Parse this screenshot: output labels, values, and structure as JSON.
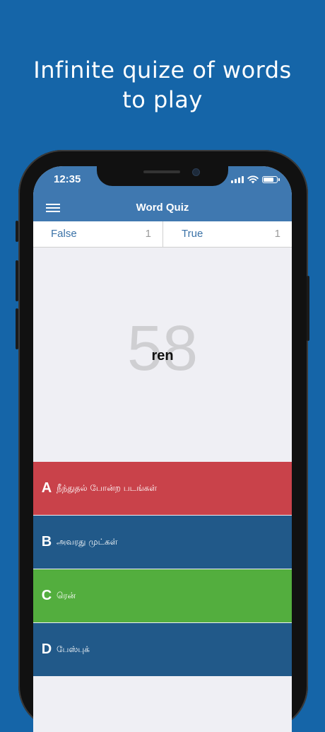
{
  "promo": {
    "headline_line1": "Infinite quize of words",
    "headline_line2": "to play"
  },
  "status_bar": {
    "time": "12:35",
    "battery_level": 0.85
  },
  "app": {
    "title": "Word Quiz"
  },
  "score": {
    "false_label": "False",
    "false_count": "1",
    "true_label": "True",
    "true_count": "1"
  },
  "question": {
    "timer": "58",
    "word": "ren"
  },
  "answers": [
    {
      "letter": "A",
      "text": "நீந்துதல் போன்ற படங்கள்",
      "color": "#c9424a"
    },
    {
      "letter": "B",
      "text": "அவரது முட்கள்",
      "color": "#215989"
    },
    {
      "letter": "C",
      "text": "ரென்",
      "color": "#53ae3e"
    },
    {
      "letter": "D",
      "text": "பேஸ்புக்",
      "color": "#215989"
    }
  ],
  "colors": {
    "background": "#1565a8",
    "nav_bar": "#3f78b0",
    "label_blue": "#3b72a7"
  }
}
